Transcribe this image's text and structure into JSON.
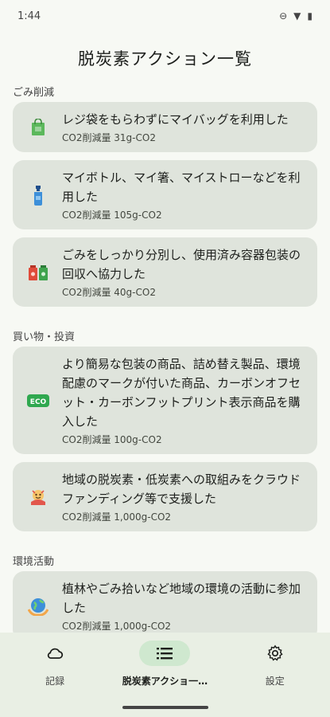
{
  "status": {
    "time": "1:44"
  },
  "page_title": "脱炭素アクション一覧",
  "sections": [
    {
      "header": "ごみ削減",
      "items": [
        {
          "title": "レジ袋をもらわずにマイバッグを利用した",
          "sub": "CO2削減量 31g-CO2",
          "icon": "shopping-bag-icon"
        },
        {
          "title": "マイボトル、マイ箸、マイストローなどを利用した",
          "sub": "CO2削減量 105g-CO2",
          "icon": "bottle-icon"
        },
        {
          "title": "ごみをしっかり分別し、使用済み容器包装の回収へ協力した",
          "sub": "CO2削減量 40g-CO2",
          "icon": "recycle-bins-icon"
        }
      ]
    },
    {
      "header": "買い物・投資",
      "items": [
        {
          "title": "より簡易な包装の商品、詰め替え製品、環境配慮のマークが付いた商品、カーボンオフセット・カーボンフットプリント表示商品を購入した",
          "sub": "CO2削減量 100g-CO2",
          "icon": "eco-badge-icon",
          "badge": "ECO"
        },
        {
          "title": "地域の脱炭素・低炭素への取組みをクラウドファンディング等で支援した",
          "sub": "CO2削減量 1,000g-CO2",
          "icon": "crowdfunding-icon"
        }
      ]
    },
    {
      "header": "環境活動",
      "items": [
        {
          "title": "植林やごみ拾いなど地域の環境の活動に参加した",
          "sub": "CO2削減量 1,000g-CO2",
          "icon": "globe-hands-icon"
        }
      ]
    }
  ],
  "nav": [
    {
      "label": "記録",
      "icon": "cloud-icon",
      "active": false
    },
    {
      "label": "脱炭素アクショ一…",
      "icon": "list-icon",
      "active": true
    },
    {
      "label": "設定",
      "icon": "gear-icon",
      "active": false
    }
  ]
}
